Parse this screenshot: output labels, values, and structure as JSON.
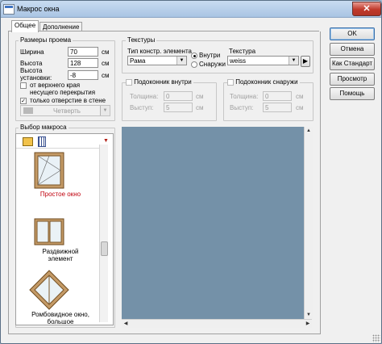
{
  "window": {
    "title": "Макрос окна",
    "close_glyph": "✕"
  },
  "tabs": [
    {
      "label": "Общее",
      "active": true
    },
    {
      "label": "Дополнение",
      "active": false
    }
  ],
  "opening": {
    "title": "Размеры проема",
    "width_label": "Ширина",
    "width_value": "70",
    "width_unit": "см",
    "height_label": "Высота",
    "height_value": "128",
    "height_unit": "см",
    "install_label_1": "Высота",
    "install_label_2": "установки:",
    "install_value": "-8",
    "install_unit": "см",
    "from_top_label_1": "от верхнего края",
    "from_top_label_2": "несущего перекрытия",
    "from_top_checked": false,
    "wall_only_label": "только отверстие в стене",
    "wall_only_checked": true,
    "quarter_value": "Четверть"
  },
  "textures": {
    "title": "Текстуры",
    "element_type_label": "Тип констр. элемента",
    "element_type_value": "Рама",
    "inside_label": "Внутри",
    "outside_label": "Снаружи",
    "selected": "inside",
    "texture_label": "Текстура",
    "texture_value": "weiss"
  },
  "sill_inside": {
    "label": "Подоконник внутри",
    "checked": false,
    "depth_label": "Толщина:",
    "depth_value": "0",
    "depth_unit": "см",
    "proj_label": "Выступ:",
    "proj_value": "5",
    "proj_unit": "см"
  },
  "sill_outside": {
    "label": "Подоконник снаружи",
    "checked": false,
    "depth_label": "Толщина:",
    "depth_value": "0",
    "depth_unit": "см",
    "proj_label": "Выступ:",
    "proj_value": "5",
    "proj_unit": "см"
  },
  "macro": {
    "title": "Выбор макроса",
    "items": [
      {
        "label": "Простое окно",
        "selected": true
      },
      {
        "label_1": "Раздвижной",
        "label_2": "элемент",
        "selected": false
      },
      {
        "label_1": "Ромбовидное окно,",
        "label_2": "большое",
        "selected": false
      }
    ]
  },
  "buttons": {
    "ok": "OK",
    "cancel": "Отмена",
    "as_standard": "Как Стандарт",
    "preview": "Просмотр",
    "help": "Помощь"
  },
  "colors": {
    "preview_bg": "#7491a8",
    "selected_text": "#c0000d",
    "close_button": "#c0392b"
  },
  "icons": [
    "window-icon",
    "close-icon",
    "dropdown-arrow-icon",
    "folder-open-icon",
    "grid-icon",
    "resize-grip-icon"
  ]
}
